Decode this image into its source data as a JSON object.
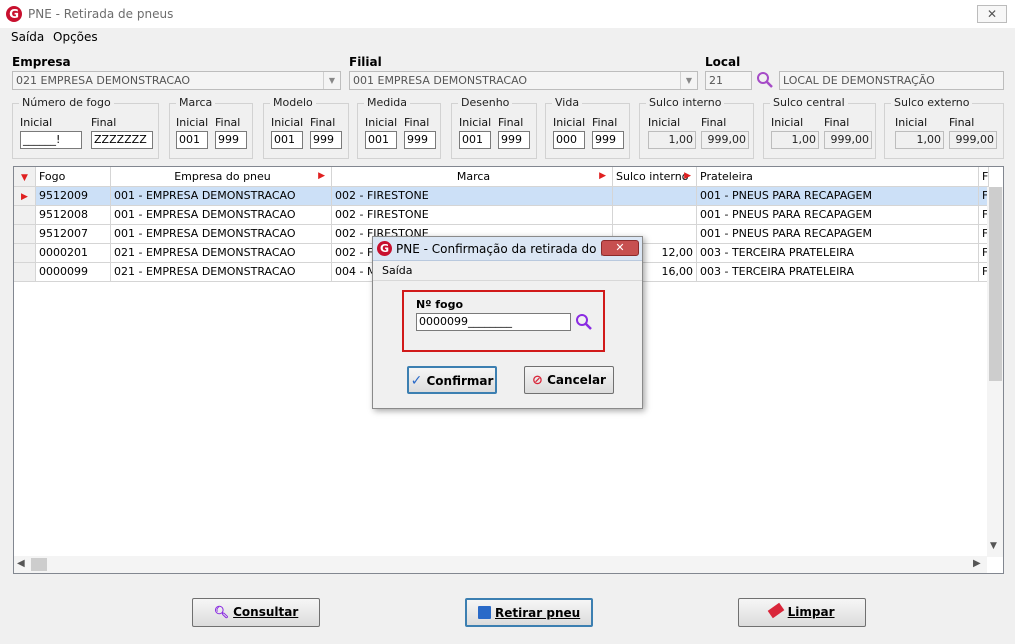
{
  "window": {
    "title": "PNE - Retirada de pneus",
    "icon": "G"
  },
  "menu": [
    "Saída",
    "Opções"
  ],
  "empresa": {
    "label": "Empresa",
    "value": "021 EMPRESA DEMONSTRACAO"
  },
  "filial": {
    "label": "Filial",
    "value": "001 EMPRESA DEMONSTRACAO"
  },
  "local": {
    "label": "Local",
    "code": "21",
    "name": "LOCAL DE DEMONSTRAÇÃO"
  },
  "filters": [
    {
      "title": "Número de fogo",
      "inicial_label": "Inicial",
      "final_label": "Final",
      "inicial": "______!",
      "final": "ZZZZZZZ"
    },
    {
      "title": "Marca",
      "inicial_label": "Inicial",
      "final_label": "Final",
      "inicial": "001",
      "final": "999"
    },
    {
      "title": "Modelo",
      "inicial_label": "Inicial",
      "final_label": "Final",
      "inicial": "001",
      "final": "999"
    },
    {
      "title": "Medida",
      "inicial_label": "Inicial",
      "final_label": "Final",
      "inicial": "001",
      "final": "999"
    },
    {
      "title": "Desenho",
      "inicial_label": "Inicial",
      "final_label": "Final",
      "inicial": "001",
      "final": "999"
    },
    {
      "title": "Vida",
      "inicial_label": "Inicial",
      "final_label": "Final",
      "inicial": "000",
      "final": "999"
    },
    {
      "title": "Sulco interno",
      "inicial_label": "Inicial",
      "final_label": "Final",
      "inicial": "1,00",
      "final": "999,00"
    },
    {
      "title": "Sulco central",
      "inicial_label": "Inicial",
      "final_label": "Final",
      "inicial": "1,00",
      "final": "999,00"
    },
    {
      "title": "Sulco externo",
      "inicial_label": "Inicial",
      "final_label": "Final",
      "inicial": "1,00",
      "final": "999,00"
    }
  ],
  "grid": {
    "columns": [
      "Fogo",
      "Empresa do pneu",
      "Marca",
      "Sulco interno",
      "Prateleira",
      "F"
    ],
    "rows": [
      {
        "fogo": "9512009",
        "empresa": "001 - EMPRESA DEMONSTRACAO",
        "marca": "002 - FIRESTONE",
        "sulco": "",
        "prateleira": "001 - PNEUS PARA RECAPAGEM",
        "f": "F"
      },
      {
        "fogo": "9512008",
        "empresa": "001 - EMPRESA DEMONSTRACAO",
        "marca": "002 - FIRESTONE",
        "sulco": "",
        "prateleira": "001 - PNEUS PARA RECAPAGEM",
        "f": "F"
      },
      {
        "fogo": "9512007",
        "empresa": "001 - EMPRESA DEMONSTRACAO",
        "marca": "002 - FIRESTONE",
        "sulco": "",
        "prateleira": "001 - PNEUS PARA RECAPAGEM",
        "f": "F"
      },
      {
        "fogo": "0000201",
        "empresa": "021 - EMPRESA DEMONSTRACAO",
        "marca": "002 - FIF",
        "sulco": "12,00",
        "prateleira": "003 - TERCEIRA PRATELEIRA",
        "f": "F"
      },
      {
        "fogo": "0000099",
        "empresa": "021 - EMPRESA DEMONSTRACAO",
        "marca": "004 - MI",
        "sulco": "16,00",
        "prateleira": "003 - TERCEIRA PRATELEIRA",
        "f": "F"
      }
    ]
  },
  "buttons": {
    "consultar": "Consultar",
    "retirar": "Retirar pneu",
    "limpar": "Limpar"
  },
  "dialog": {
    "title": "PNE - Confirmação da retirada do pn...",
    "menu": "Saída",
    "field_label": "Nº  fogo",
    "field_value": "0000099________",
    "confirm": "Confirmar",
    "cancel": "Cancelar"
  }
}
